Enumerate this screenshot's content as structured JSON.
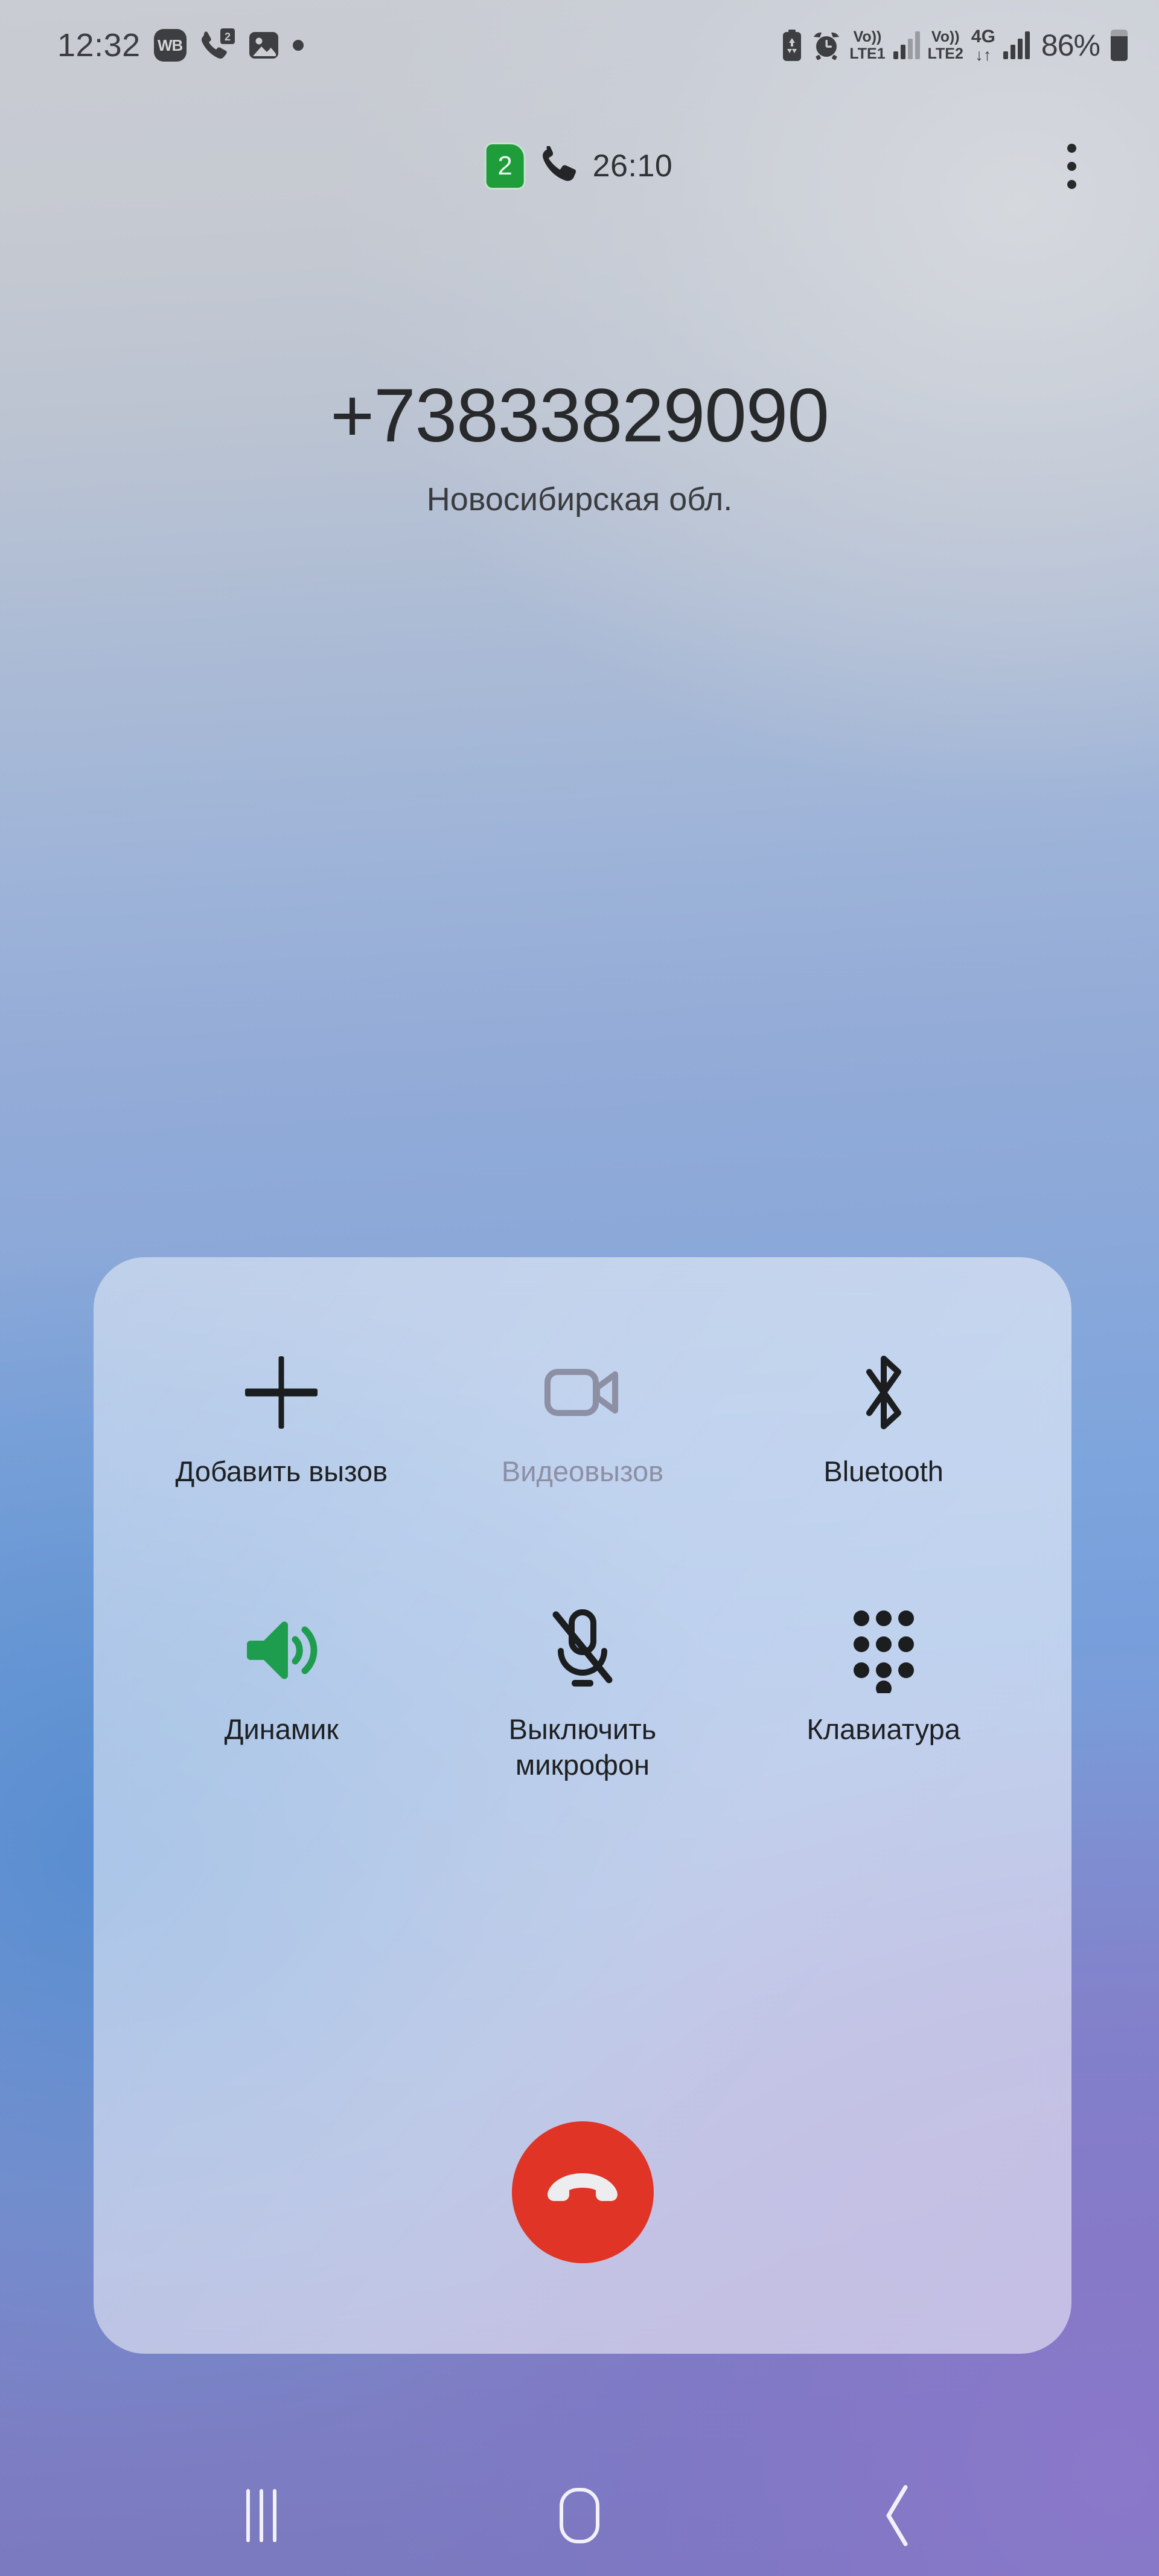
{
  "statusbar": {
    "clock": "12:32",
    "wb_badge": "WB",
    "missed_calls_badge": "2",
    "icons_left": [
      "wildberries-icon",
      "missed-call-icon",
      "image-icon",
      "dot-icon"
    ],
    "sim1_label_top": "Vo))",
    "sim1_label_bottom": "LTE1",
    "sim2_label_top": "Vo))",
    "sim2_label_bottom": "LTE2",
    "network_type": "4G",
    "data_arrows": "↓↑",
    "battery_percent": "86%",
    "icons_right": [
      "battery-saver-icon",
      "alarm-icon",
      "volte-sim1-icon",
      "signal-sim1-icon",
      "volte-sim2-icon",
      "data-4g-icon",
      "signal-sim2-icon",
      "battery-icon"
    ]
  },
  "call_header": {
    "sim_badge": "2",
    "phone_icon": "phone-handset-icon",
    "duration": "26:10",
    "overflow_icon": "more-vertical-icon"
  },
  "caller": {
    "number": "+73833829090",
    "region": "Новосибирская обл."
  },
  "controls": {
    "buttons": [
      {
        "id": "add-call",
        "label": "Добавить вызов",
        "icon": "plus-icon",
        "state": "enabled"
      },
      {
        "id": "video-call",
        "label": "Видеовызов",
        "icon": "video-camera-icon",
        "state": "disabled"
      },
      {
        "id": "bluetooth",
        "label": "Bluetooth",
        "icon": "bluetooth-icon",
        "state": "enabled"
      },
      {
        "id": "speaker",
        "label": "Динамик",
        "icon": "speaker-icon",
        "state": "active"
      },
      {
        "id": "mute",
        "label": "Выключить микрофон",
        "icon": "mic-off-icon",
        "state": "enabled"
      },
      {
        "id": "keypad",
        "label": "Клавиатура",
        "icon": "dialpad-icon",
        "state": "enabled"
      }
    ],
    "end_call": {
      "icon": "end-call-icon",
      "color": "#e03426"
    }
  },
  "navbar": {
    "recents": "recents-icon",
    "home": "home-icon",
    "back": "back-icon"
  },
  "colors": {
    "accent_green": "#1f9d3b",
    "end_call_red": "#e03426",
    "text_primary": "#1e2022",
    "text_disabled": "#8d8fa4"
  }
}
